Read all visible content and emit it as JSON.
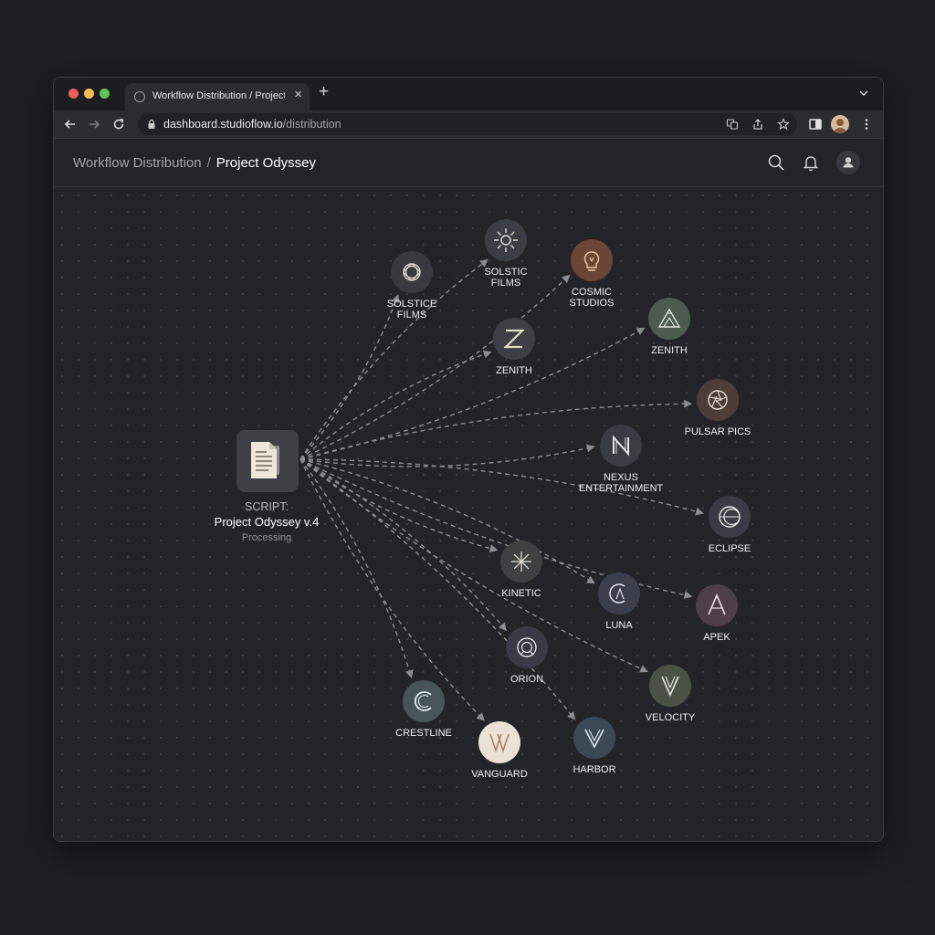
{
  "browser": {
    "tab_title": "Workflow Distribution / Project Odyssey",
    "tab_close": "×",
    "new_tab": "+",
    "url_host": "dashboard.studioflow.io",
    "url_path": "/distribution"
  },
  "header": {
    "breadcrumb_parent": "Workflow Distribution",
    "breadcrumb_separator": "/",
    "breadcrumb_current": "Project Odyssey"
  },
  "source": {
    "line1": "SCRIPT:",
    "line2": "Project Odyssey v.4",
    "status": "Processing",
    "icon": "document-icon"
  },
  "colors": {
    "canvas_bg": "#232428",
    "edge": "#8a8c91",
    "node_default": "#383a40",
    "cosmic": "#6b4636",
    "zenith2": "#4c5a50",
    "pulsar": "#4e3c37",
    "apex": "#4d3e48",
    "velocity": "#4a5246",
    "crestline": "#475559",
    "vanguard": "#e9e2d5",
    "harbor": "#3d4855"
  },
  "nodes": [
    {
      "label": "SOLSTICE\nFILMS",
      "icon": "swirl-icon",
      "color": "#383a40"
    },
    {
      "label": "SOLSTIC\nFILMS",
      "icon": "sun-icon",
      "color": "#3b3e45"
    },
    {
      "label": "COSMIC\nSTUDIOS",
      "icon": "lightbulb-icon",
      "color": "#6b4636"
    },
    {
      "label": "ZENITH",
      "icon": "z-icon",
      "color": "#3d3f44"
    },
    {
      "label": "ZENITH",
      "icon": "mountain-icon",
      "color": "#4c5a50"
    },
    {
      "label": "PULSAR PICS",
      "icon": "aperture-icon",
      "color": "#4e3c37"
    },
    {
      "label": "NEXUS\nENTERTAINMENT",
      "icon": "n-icon",
      "color": "#3a3c43"
    },
    {
      "label": "ECLIPSE",
      "icon": "eclipse-icon",
      "color": "#393c44"
    },
    {
      "label": "KINETIC",
      "icon": "asterisk-icon",
      "color": "#3f4040"
    },
    {
      "label": "LUNA",
      "icon": "crescent-icon",
      "color": "#3b3f4c"
    },
    {
      "label": "APEK",
      "icon": "peak-icon",
      "color": "#4d3e48"
    },
    {
      "label": "ORION",
      "icon": "ring-icon",
      "color": "#383b45"
    },
    {
      "label": "VELOCITY",
      "icon": "chevron-v-icon",
      "color": "#4a5246"
    },
    {
      "label": "CRESTLINE",
      "icon": "c-icon",
      "color": "#475559"
    },
    {
      "label": "VANGUARD",
      "icon": "double-v-icon",
      "color": "#e9e2d5"
    },
    {
      "label": "HARBOR",
      "icon": "harbor-v-icon",
      "color": "#3d4855"
    }
  ]
}
